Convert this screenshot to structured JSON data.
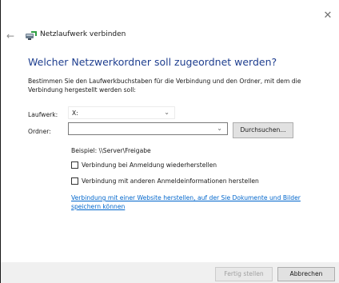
{
  "window": {
    "title": "Netzlaufwerk verbinden",
    "close_glyph": "✕",
    "back_glyph": "←",
    "icons": {
      "close": "close-icon",
      "back": "back-arrow-icon",
      "app": "network-drive-icon"
    }
  },
  "main": {
    "heading": "Welcher Netzwerkordner soll zugeordnet werden?",
    "instruction": "Bestimmen Sie den Laufwerkbuchstaben für die Verbindung und den Ordner, mit dem die Verbindung hergestellt werden soll:",
    "drive": {
      "label": "Laufwerk:",
      "value": "X:"
    },
    "folder": {
      "label": "Ordner:",
      "value": ""
    },
    "browse_label": "Durchsuchen...",
    "example": "Beispiel: \\\\Server\\Freigabe",
    "reconnect_label": "Verbindung bei Anmeldung wiederherstellen",
    "reconnect_checked": false,
    "credentials_label": "Verbindung mit anderen Anmeldeinformationen herstellen",
    "credentials_checked": false,
    "link_text": "Verbindung mit einer Website herstellen, auf der Sie Dokumente und Bilder speichern können"
  },
  "footer": {
    "finish_label": "Fertig stellen",
    "finish_enabled": false,
    "cancel_label": "Abbrechen"
  },
  "colors": {
    "heading": "#1e3e8f",
    "link": "#0066cc",
    "footer_bg": "#f0f0f0"
  }
}
